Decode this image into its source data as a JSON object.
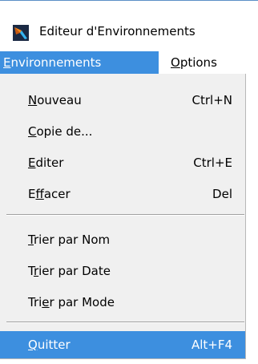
{
  "window": {
    "title": "Editeur d'Environnements",
    "icon": "app-icon"
  },
  "menubar": {
    "items": [
      {
        "label_underline": "E",
        "label_rest": "nvironnements",
        "active": true
      },
      {
        "label_underline": "O",
        "label_rest": "ptions",
        "active": false
      }
    ]
  },
  "menu": {
    "items": [
      {
        "pre": "",
        "u": "N",
        "post": "ouveau",
        "accel": "Ctrl+N"
      },
      {
        "pre": "",
        "u": "C",
        "post": "opie de...",
        "accel": ""
      },
      {
        "pre": "",
        "u": "E",
        "post": "diter",
        "accel": "Ctrl+E"
      },
      {
        "pre": "E",
        "u": "f",
        "post": "facer",
        "accel": "Del"
      },
      {
        "pre": "",
        "u": "T",
        "post": "rier par Nom",
        "accel": ""
      },
      {
        "pre": "T",
        "u": "r",
        "post": "ier par Date",
        "accel": ""
      },
      {
        "pre": "Tri",
        "u": "e",
        "post": "r par Mode",
        "accel": ""
      },
      {
        "pre": "",
        "u": "Q",
        "post": "uitter",
        "accel": "Alt+F4",
        "highlighted": true
      }
    ]
  },
  "colors": {
    "highlight": "#3d8fdf",
    "menu_background": "#f0f0f0",
    "highlight_text": "#ffffff"
  }
}
